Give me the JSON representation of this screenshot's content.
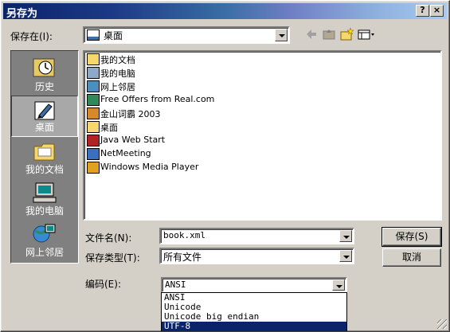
{
  "window": {
    "title": "另存为",
    "help_btn": "?",
    "close_btn": "×"
  },
  "save_in": {
    "label": "保存在(I):",
    "value": "桌面"
  },
  "toolbar": {
    "icons": [
      "back-arrow-icon",
      "up-folder-icon",
      "new-folder-icon",
      "view-menu-icon"
    ]
  },
  "places": [
    {
      "label": "历史",
      "icon": "history-icon"
    },
    {
      "label": "桌面",
      "icon": "desktop-icon",
      "selected": true
    },
    {
      "label": "我的文档",
      "icon": "my-documents-icon"
    },
    {
      "label": "我的电脑",
      "icon": "my-computer-icon"
    },
    {
      "label": "网上邻居",
      "icon": "network-places-icon"
    }
  ],
  "files": [
    {
      "name": "我的文档",
      "icon": "my-documents-icon",
      "color": "#f5d76e"
    },
    {
      "name": "我的电脑",
      "icon": "my-computer-icon",
      "color": "#8fa8c8"
    },
    {
      "name": "网上邻居",
      "icon": "network-places-icon",
      "color": "#4a8fbd"
    },
    {
      "name": "Free Offers from Real.com",
      "icon": "real-icon",
      "color": "#2e8b57"
    },
    {
      "name": "金山词霸 2003",
      "icon": "kingsoft-icon",
      "color": "#d48a2a"
    },
    {
      "name": "桌面",
      "icon": "folder-icon",
      "color": "#f5d76e"
    },
    {
      "name": "Java Web Start",
      "icon": "java-icon",
      "color": "#b22222"
    },
    {
      "name": "NetMeeting",
      "icon": "netmeeting-icon",
      "color": "#3a70c0"
    },
    {
      "name": "Windows Media Player",
      "icon": "media-player-icon",
      "color": "#e0a020"
    }
  ],
  "filename": {
    "label": "文件名(N):",
    "value": "book.xml"
  },
  "filetype": {
    "label": "保存类型(T):",
    "value": "所有文件"
  },
  "encoding": {
    "label": "编码(E):",
    "value": "ANSI",
    "options": [
      "ANSI",
      "Unicode",
      "Unicode big endian",
      "UTF-8"
    ],
    "highlighted": "UTF-8"
  },
  "buttons": {
    "save": "保存(S)",
    "cancel": "取消"
  }
}
